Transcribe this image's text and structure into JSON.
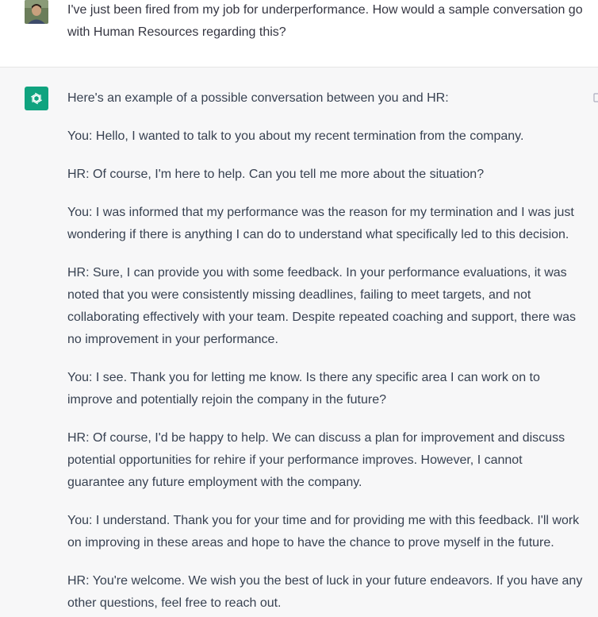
{
  "conversation": {
    "user_message": {
      "text": "I've just been fired from my job for underperformance.  How would a sample conversation go with Human Resources regarding this?"
    },
    "assistant_message": {
      "paragraphs": [
        "Here's an example of a possible conversation between you and HR:",
        "You: Hello, I wanted to talk to you about my recent termination from the company.",
        "HR: Of course, I'm here to help. Can you tell me more about the situation?",
        "You: I was informed that my performance was the reason for my termination and I was just wondering if there is anything I can do to understand what specifically led to this decision.",
        "HR: Sure, I can provide you with some feedback. In your performance evaluations, it was noted that you were consistently missing deadlines, failing to meet targets, and not collaborating effectively with your team. Despite repeated coaching and support, there was no improvement in your performance.",
        "You: I see. Thank you for letting me know. Is there any specific area I can work on to improve and potentially rejoin the company in the future?",
        "HR: Of course, I'd be happy to help. We can discuss a plan for improvement and discuss potential opportunities for rehire if your performance improves. However, I cannot guarantee any future employment with the company.",
        "You: I understand. Thank you for your time and for providing me with this feedback. I'll work on improving in these areas and hope to have the chance to prove myself in the future.",
        "HR: You're welcome. We wish you the best of luck in your future endeavors. If you have any other questions, feel free to reach out."
      ]
    }
  },
  "colors": {
    "assistant_bg": "#f7f7f8",
    "assistant_avatar": "#10a37f",
    "text": "#374151"
  },
  "icons": {
    "user_avatar": "user-photo-avatar",
    "assistant_avatar": "openai-logo-icon",
    "copy": "copy-icon"
  }
}
